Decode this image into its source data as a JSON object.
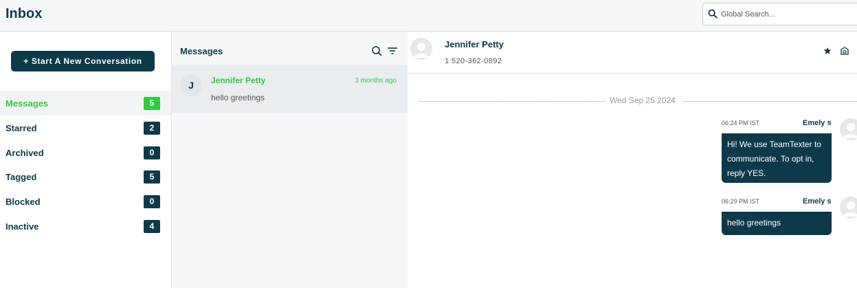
{
  "header": {
    "title": "Inbox",
    "search_placeholder": "Global Search..."
  },
  "sidebar": {
    "new_conversation_label": "+ Start A New Conversation",
    "items": [
      {
        "label": "Messages",
        "count": "5"
      },
      {
        "label": "Starred",
        "count": "2"
      },
      {
        "label": "Archived",
        "count": "0"
      },
      {
        "label": "Tagged",
        "count": "5"
      },
      {
        "label": "Blocked",
        "count": "0"
      },
      {
        "label": "Inactive",
        "count": "4"
      }
    ]
  },
  "messages_panel": {
    "title": "Messages",
    "conversations": [
      {
        "initial": "J",
        "name": "Jennifer Petty",
        "time": "3 months ago",
        "preview": "hello greetings"
      }
    ]
  },
  "chat": {
    "contact_name": "Jennifer Petty",
    "contact_phone": "1 520-362-0892",
    "date_separator": "Wed Sep 25 2024",
    "messages": [
      {
        "time": "06:24 PM IST",
        "sender": "Emely s",
        "text": "Hi! We use TeamTexter to communicate. To opt in, reply YES."
      },
      {
        "time": "06:29 PM IST",
        "sender": "Emely s",
        "text": "hello greetings"
      }
    ]
  },
  "colors": {
    "primary": "#0d3a4a",
    "accent": "#2ecc40"
  },
  "icons": [
    "search-icon",
    "filter-icon",
    "star-icon",
    "archive-icon",
    "avatar-placeholder-icon"
  ]
}
